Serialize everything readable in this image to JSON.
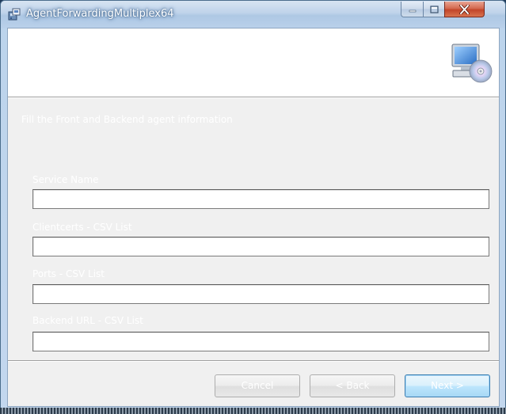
{
  "window": {
    "title": "AgentForwardingMultiplex64",
    "app_icon": "installer-package-icon",
    "controls": {
      "minimize": "minimize-icon",
      "maximize": "maximize-icon",
      "close": "close-icon"
    }
  },
  "banner": {
    "icon": "computer-with-disc-icon"
  },
  "instruction": "Fill the Front and Backend agent information",
  "fields": [
    {
      "label": "Service Name",
      "value": ""
    },
    {
      "label": "Clientcerts - CSV List",
      "value": ""
    },
    {
      "label": "Ports - CSV List",
      "value": ""
    },
    {
      "label": "Backend URL - CSV List",
      "value": ""
    }
  ],
  "buttons": {
    "cancel": "Cancel",
    "back": "< Back",
    "next": "Next >"
  },
  "colors": {
    "frame": "#b9d1ea",
    "client_bg": "#f0f0f0",
    "close_red": "#c2452a",
    "next_blue": "#3c7fb1"
  }
}
